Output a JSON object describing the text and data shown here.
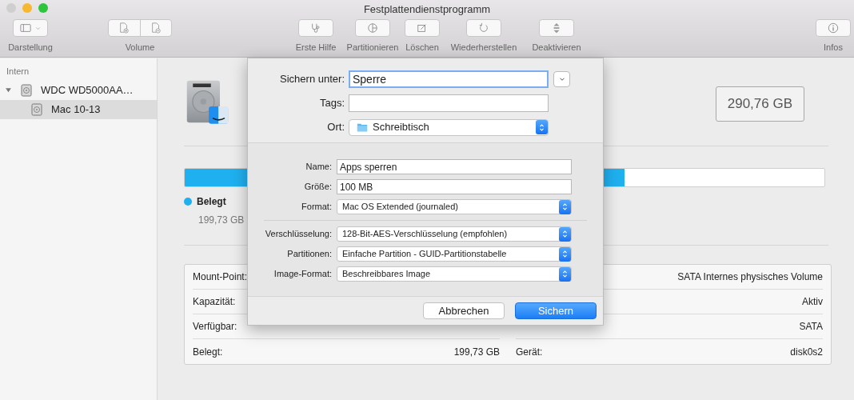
{
  "window": {
    "title": "Festplattendienstprogramm"
  },
  "toolbar": {
    "left": [
      {
        "label": "Darstellung",
        "kind": "view"
      },
      {
        "label": "Volume",
        "kind": "volume"
      }
    ],
    "center": [
      {
        "label": "Erste Hilfe",
        "kind": "firstaid"
      },
      {
        "label": "Partitionieren",
        "kind": "partition"
      },
      {
        "label": "Löschen",
        "kind": "erase"
      },
      {
        "label": "Wiederherstellen",
        "kind": "restore"
      },
      {
        "label": "Deaktivieren",
        "kind": "unmount"
      }
    ],
    "right": [
      {
        "label": "Infos",
        "kind": "info"
      }
    ]
  },
  "sidebar": {
    "section": "Intern",
    "items": [
      {
        "label": "WDC WD5000AA…",
        "expanded": true,
        "selected": false,
        "children": [
          {
            "label": "Mac 10-13",
            "selected": true
          }
        ]
      }
    ]
  },
  "volume": {
    "capacity": "290,76 GB",
    "usage": {
      "level": 0.687,
      "legend": "Belegt",
      "value": "199,73 GB",
      "color": "#1fb0f0"
    }
  },
  "info": {
    "left": [
      {
        "label": "Mount-Point:"
      },
      {
        "label": "Kapazität:"
      },
      {
        "label": "Verfügbar:"
      },
      {
        "label": "Belegt:",
        "value": "199,73 GB"
      }
    ],
    "right": [
      {
        "value": "SATA Internes physisches Volume"
      },
      {
        "value": "Aktiv"
      },
      {
        "value": "SATA"
      },
      {
        "label": "Gerät:",
        "value": "disk0s2"
      }
    ]
  },
  "dialog": {
    "top": [
      {
        "label": "Sichern unter:",
        "kind": "text",
        "value": "Sperre",
        "focused": true
      },
      {
        "label": "Tags:",
        "kind": "text",
        "focused": false
      },
      {
        "label": "Ort:",
        "kind": "folder",
        "value": "Schreibtisch"
      }
    ],
    "fields": [
      {
        "label": "Name:",
        "kind": "text",
        "value": "Apps sperren"
      },
      {
        "label": "Größe:",
        "kind": "text",
        "value": "100 MB"
      },
      {
        "label": "Format:",
        "kind": "select",
        "value": "Mac OS Extended (journaled)"
      },
      {
        "kind": "divider"
      },
      {
        "label": "Verschlüsselung:",
        "kind": "select",
        "value": "128-Bit-AES-Verschlüsselung (empfohlen)"
      },
      {
        "label": "Partitionen:",
        "kind": "select",
        "value": "Einfache Partition - GUID-Partitionstabelle"
      },
      {
        "label": "Image-Format:",
        "kind": "select",
        "value": "Beschreibbares Image"
      }
    ],
    "buttons": [
      {
        "label": "Abbrechen",
        "default": false
      },
      {
        "label": "Sichern",
        "default": true
      }
    ]
  }
}
